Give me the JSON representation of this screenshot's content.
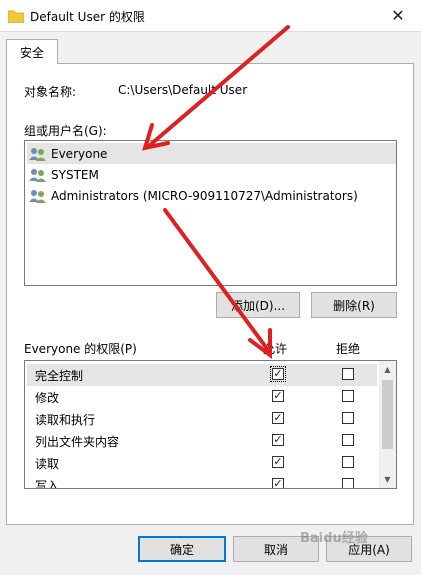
{
  "window": {
    "title": "Default User 的权限",
    "close_glyph": "✕"
  },
  "tab": {
    "label": "安全"
  },
  "object": {
    "label": "对象名称:",
    "value": "C:\\Users\\Default User"
  },
  "groups": {
    "label": "组或用户名(G):",
    "items": [
      {
        "name": "Everyone"
      },
      {
        "name": "SYSTEM"
      },
      {
        "name": "Administrators (MICRO-909110727\\Administrators)"
      }
    ]
  },
  "buttons": {
    "add": "添加(D)...",
    "remove": "删除(R)",
    "ok": "确定",
    "cancel": "取消",
    "apply": "应用(A)"
  },
  "permissions": {
    "label": "Everyone 的权限(P)",
    "allow_header": "允许",
    "deny_header": "拒绝",
    "rows": [
      {
        "name": "完全控制",
        "allow": true,
        "deny": false
      },
      {
        "name": "修改",
        "allow": true,
        "deny": false
      },
      {
        "name": "读取和执行",
        "allow": true,
        "deny": false
      },
      {
        "name": "列出文件夹内容",
        "allow": true,
        "deny": false
      },
      {
        "name": "读取",
        "allow": true,
        "deny": false
      },
      {
        "name": "写入",
        "allow": true,
        "deny": false
      }
    ]
  },
  "watermark": "Baidu经验",
  "colors": {
    "accent": "#0078d7",
    "annotation_arrow": "#e02020",
    "folder": "#f5c542"
  },
  "icons": {
    "folder": "folder-icon",
    "close": "close-icon",
    "user_group": "user-group-icon",
    "scroll_up": "scroll-up-icon",
    "scroll_down": "scroll-down-icon"
  }
}
